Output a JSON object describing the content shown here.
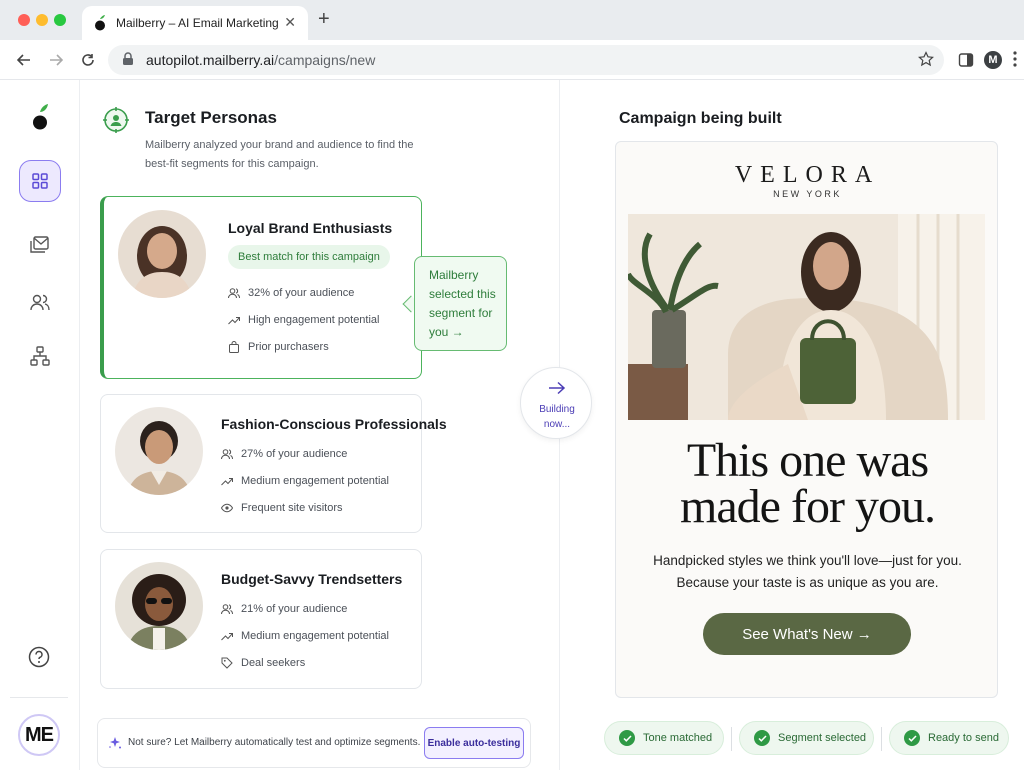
{
  "browser": {
    "tab_title": "Mailberry – AI Email Marketing",
    "url_host": "autopilot.mailberry.ai",
    "url_path": "/campaigns/new",
    "profile_initial": "M"
  },
  "sidebar": {
    "items": [
      {
        "name": "dashboard",
        "icon": "grid-icon",
        "active": true
      },
      {
        "name": "campaigns",
        "icon": "mail-icon",
        "active": false
      },
      {
        "name": "audience",
        "icon": "users-icon",
        "active": false
      },
      {
        "name": "flows",
        "icon": "hierarchy-icon",
        "active": false
      }
    ],
    "user_badge": "ME"
  },
  "personas": {
    "title": "Target Personas",
    "description": "Mailberry analyzed your brand and audience to find the best-fit segments for this campaign.",
    "cards": [
      {
        "name": "Loyal Brand Enthusiasts",
        "badge": "Best match for this campaign",
        "stats": [
          "32% of your audience",
          "High engagement potential",
          "Prior purchasers"
        ],
        "selected": true
      },
      {
        "name": "Fashion-Conscious Professionals",
        "stats": [
          "27% of your audience",
          "Medium engagement potential",
          "Frequent site visitors"
        ],
        "selected": false
      },
      {
        "name": "Budget-Savvy Trendsetters",
        "stats": [
          "21% of your audience",
          "Medium engagement potential",
          "Deal seekers"
        ],
        "selected": false
      }
    ],
    "tooltip_lines": [
      "Mailberry",
      "selected this",
      "segment for",
      "you →"
    ],
    "auto_prompt": "Not sure? Let Mailberry automatically test and optimize segments.",
    "auto_button": "Enable auto-testing"
  },
  "building": {
    "line1": "Building",
    "line2": "now..."
  },
  "campaign": {
    "title": "Campaign being built",
    "brand": "VELORA",
    "brand_sub": "NEW YORK",
    "headline_1": "This one was",
    "headline_2": "made for you.",
    "subtext_1": "Handpicked styles we think you'll love—just for you.",
    "subtext_2": "Because your taste is as unique as you are.",
    "cta": "See What's New →"
  },
  "status": {
    "items": [
      "Tone matched",
      "Segment selected",
      "Ready to send"
    ]
  },
  "colors": {
    "accent_purple": "#8b7cf0",
    "match_green": "#3a9d4c",
    "cta_olive": "#5a6844"
  }
}
